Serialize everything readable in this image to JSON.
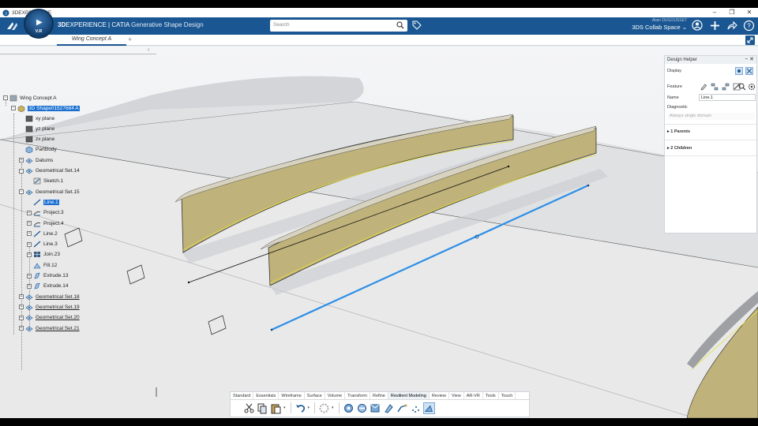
{
  "os_bar": {
    "title": "3DEXPERIENCE",
    "minimize": "–",
    "restore": "❐",
    "close": "✕"
  },
  "header": {
    "brand_bold": "3D",
    "brand_main": "EXPERIENCE | CATIA",
    "brand_app": "Generative Shape Design",
    "compass_label": "V.R",
    "search_placeholder": "Search",
    "user": "Alain DUGOUSSET",
    "collab_space": "3DS Collab Space ⌄"
  },
  "tabs": {
    "active": "Wing Concept A",
    "add": "+"
  },
  "tree": {
    "collapse": "‹",
    "root": "Wing Concept A",
    "shape": "3D Shape01527684 A",
    "items": [
      {
        "label": "xy plane",
        "icon": "plane-icon"
      },
      {
        "label": "yz plane",
        "icon": "plane-icon"
      },
      {
        "label": "zx plane",
        "icon": "plane-icon"
      },
      {
        "label": "PartBody",
        "icon": "partbody-icon"
      },
      {
        "label": "Datums",
        "icon": "geoset-icon"
      },
      {
        "label": "Geometrical Set.14",
        "icon": "geoset-icon"
      },
      {
        "label": "Sketch.1",
        "icon": "sketch-icon"
      },
      {
        "label": "Geometrical Set.15",
        "icon": "geoset-icon"
      },
      {
        "label": "Line.1",
        "icon": "line-icon"
      },
      {
        "label": "Project.3",
        "icon": "project-icon"
      },
      {
        "label": "Project.4",
        "icon": "project-icon"
      },
      {
        "label": "Line.2",
        "icon": "line-icon"
      },
      {
        "label": "Line.3",
        "icon": "line-icon"
      },
      {
        "label": "Join.23",
        "icon": "join-icon"
      },
      {
        "label": "Fill.12",
        "icon": "fill-icon"
      },
      {
        "label": "Extrude.13",
        "icon": "extrude-icon"
      },
      {
        "label": "Extrude.14",
        "icon": "extrude-icon"
      },
      {
        "label": "Geometrical Set.18",
        "icon": "geoset-icon"
      },
      {
        "label": "Geometrical Set.19",
        "icon": "geoset-icon"
      },
      {
        "label": "Geometrical Set.20",
        "icon": "geoset-icon"
      },
      {
        "label": "Geometrical Set.21",
        "icon": "geoset-icon"
      }
    ]
  },
  "design_helper": {
    "title": "Design Helper",
    "display_label": "Display",
    "feature_label": "Feature",
    "name_label": "Name",
    "name_value": "Line.1",
    "diagnostic_label": "Diagnostic",
    "diagnostic_value": "Always single domain",
    "parents": "1 Parents",
    "children": "2 Children"
  },
  "action_bar": {
    "tabs": [
      "Standard",
      "Essentials",
      "Wireframe",
      "Surface",
      "Volume",
      "Transform",
      "Refine",
      "Resilient Modeling",
      "Review",
      "View",
      "AR-VR",
      "Tools",
      "Touch"
    ],
    "active_tab": "Resilient Modeling"
  },
  "colors": {
    "header_blue": "#1a5792",
    "selection_blue": "#1a6fd0",
    "surface_gold": "#bfb27a",
    "line_blue": "#2d8fe6"
  }
}
